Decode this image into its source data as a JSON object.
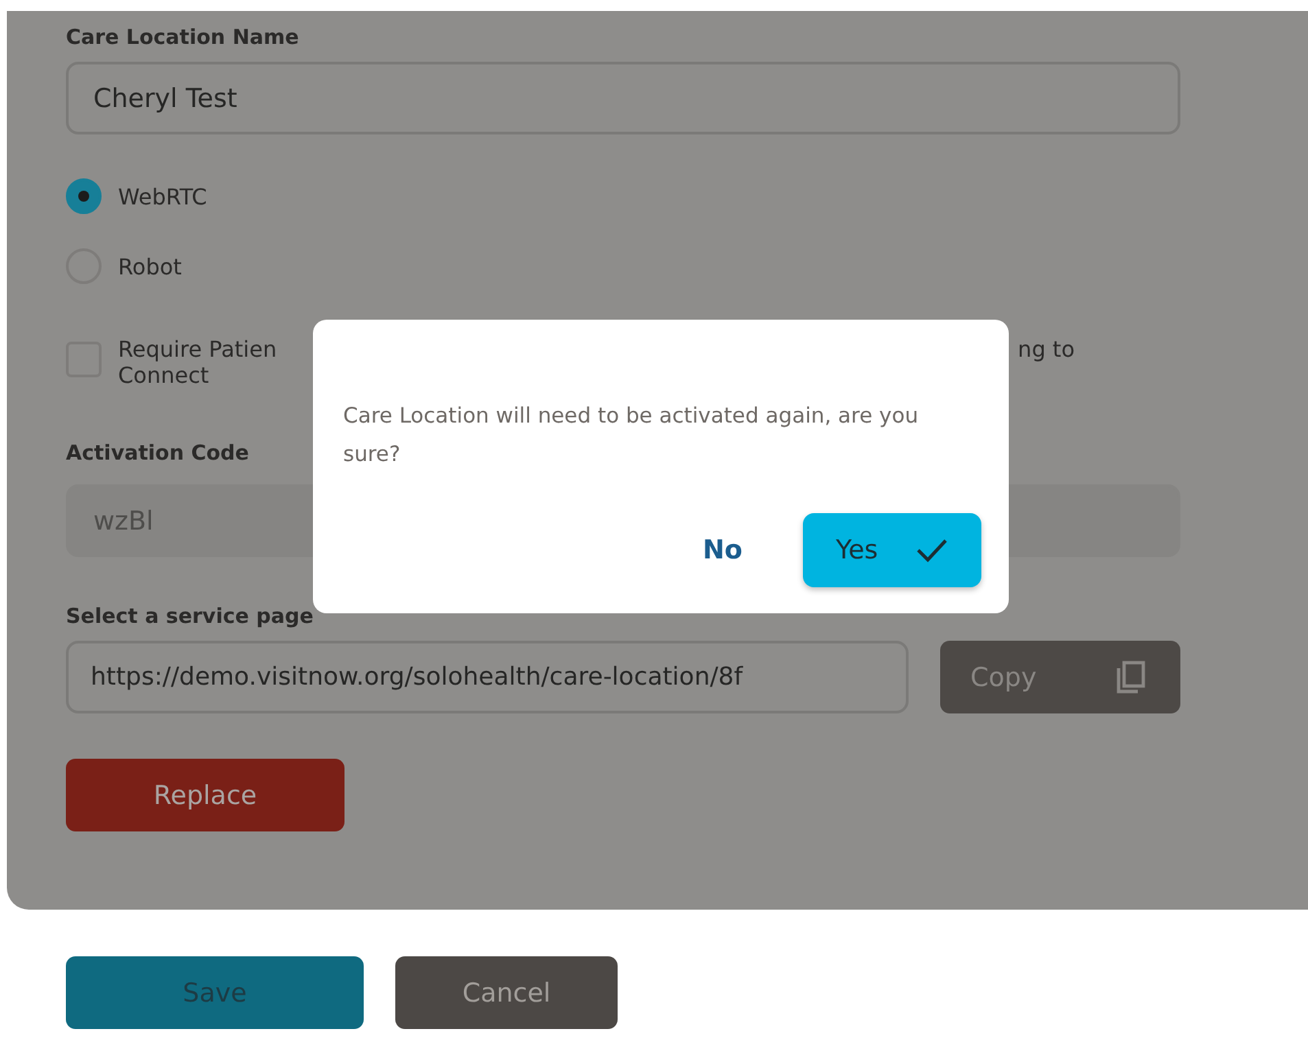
{
  "form": {
    "name_label": "Care Location Name",
    "name_value": "Cheryl Test",
    "connection_options": [
      {
        "label": "WebRTC",
        "selected": true
      },
      {
        "label": "Robot",
        "selected": false
      }
    ],
    "require_checkbox": {
      "checked": false,
      "label_line1_start": "Require Patien",
      "label_line1_end": "ng to",
      "label_line2": "Connect"
    },
    "activation_label": "Activation Code",
    "activation_value": "wzBl",
    "service_label": "Select a service page",
    "service_value": "https://demo.visitnow.org/solohealth/care-location/8f",
    "copy_button": "Copy",
    "replace_button": "Replace"
  },
  "footer_buttons": [
    {
      "kind": "primary",
      "label": "Save"
    },
    {
      "kind": "secondary",
      "label": "Cancel"
    }
  ],
  "dialog": {
    "message": "Care Location will need to be activated again, are you sure?",
    "no_button": "No",
    "yes_button": "Yes"
  }
}
